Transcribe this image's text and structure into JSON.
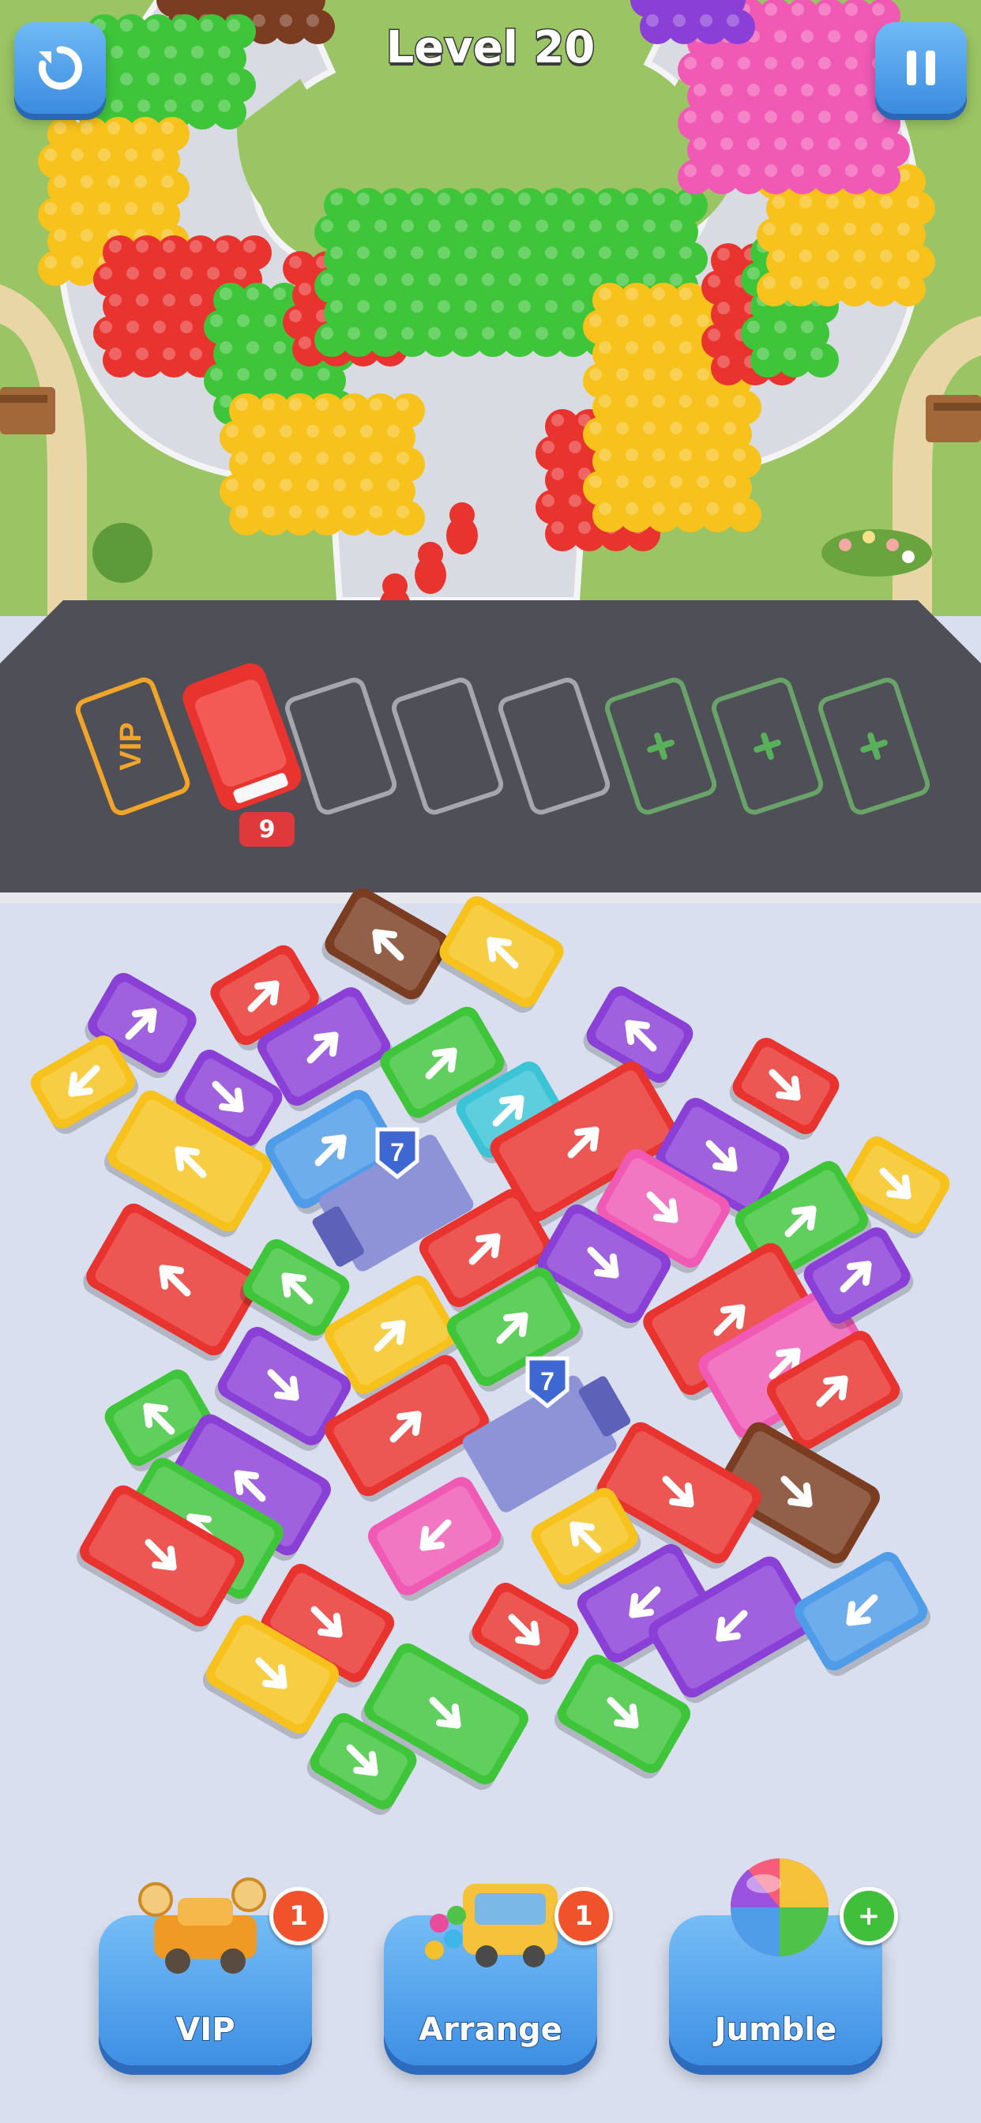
{
  "hud": {
    "level_title": "Level 20",
    "restart_icon": "restart-icon",
    "pause_icon": "pause-icon"
  },
  "parking": {
    "vip_label": "VIP",
    "bus_passenger_count": "9",
    "locked_slot_icon": "plus-icon"
  },
  "boosters": {
    "vip": {
      "label": "VIP",
      "count": "1"
    },
    "arrange": {
      "label": "Arrange",
      "count": "1"
    },
    "jumble": {
      "label": "Jumble",
      "badge": "+"
    }
  },
  "truck_badges": [
    "7",
    "7"
  ],
  "colors": {
    "red": "#e8332f",
    "green": "#3fc53a",
    "yellow": "#f6c21b",
    "purple": "#8a3fd6",
    "pink": "#f05ab5",
    "blue": "#4f9ce8",
    "cyan": "#3ac4d6",
    "brown": "#7a3d22",
    "road": "#4f4f57",
    "grass": "#9bc464"
  }
}
